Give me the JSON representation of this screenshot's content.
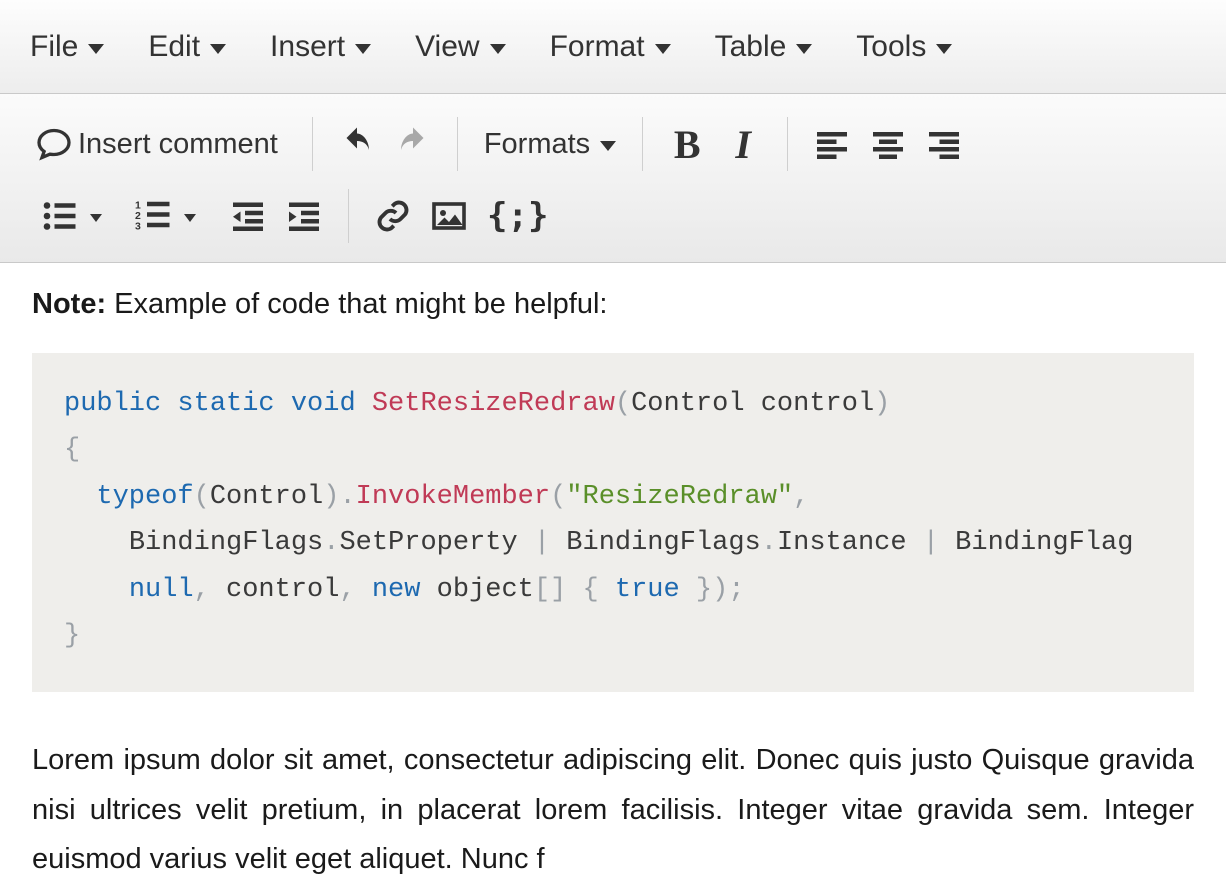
{
  "menubar": {
    "file": "File",
    "edit": "Edit",
    "insert": "Insert",
    "view": "View",
    "format": "Format",
    "table": "Table",
    "tools": "Tools"
  },
  "toolbar": {
    "insert_comment": "Insert comment",
    "formats": "Formats"
  },
  "content": {
    "note_label": "Note:",
    "note_text": " Example of code that might be helpful:",
    "code": {
      "l1_kw1": "public",
      "l1_kw2": "static",
      "l1_kw3": "void",
      "l1_fn": "SetResizeRedraw",
      "l1_paren_open": "(",
      "l1_type": "Control",
      "l1_arg": " control",
      "l1_paren_close": ")",
      "l2_brace": "{",
      "l3_indent": "  ",
      "l3_kw": "typeof",
      "l3_p1": "(",
      "l3_t": "Control",
      "l3_p2": ")",
      "l3_dot": ".",
      "l3_fn": "InvokeMember",
      "l3_p3": "(",
      "l3_str": "\"ResizeRedraw\"",
      "l3_comma": ",",
      "l4_indent": "    ",
      "l4_a": "BindingFlags",
      "l4_d1": ".",
      "l4_b": "SetProperty ",
      "l4_pipe1": "|",
      "l4_c": " BindingFlags",
      "l4_d2": ".",
      "l4_d": "Instance ",
      "l4_pipe2": "|",
      "l4_e": " BindingFlag",
      "l5_indent": "    ",
      "l5_null": "null",
      "l5_c1": ",",
      "l5_ctrl": " control",
      "l5_c2": ",",
      "l5_new": " new",
      "l5_obj": " object",
      "l5_br": "[] { ",
      "l5_true": "true",
      "l5_end": " });",
      "l6_brace": "}"
    },
    "paragraph": "Lorem ipsum dolor sit amet, consectetur adipiscing elit. Donec quis justo Quisque gravida nisi ultrices velit pretium, in placerat lorem facilisis. Integer vitae gravida sem. Integer euismod varius velit eget aliquet. Nunc f"
  }
}
